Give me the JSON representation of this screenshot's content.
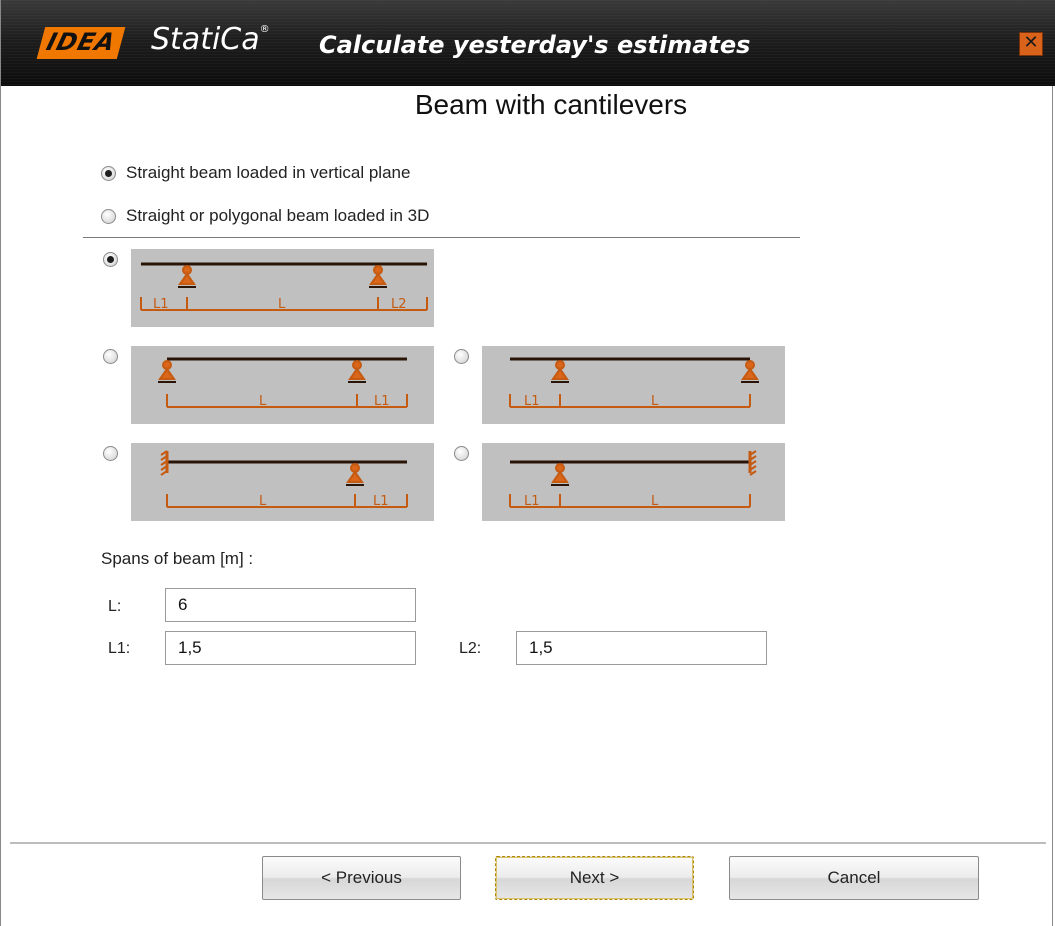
{
  "header": {
    "logo_idea": "IDEA",
    "logo_statica": "StatiCa",
    "logo_reg": "®",
    "tagline": "Calculate yesterday's estimates",
    "close_glyph": "✕",
    "accent_color": "#f07800"
  },
  "dialog": {
    "title": "Beam with cantilevers"
  },
  "load_type": {
    "options": [
      {
        "label": "Straight beam loaded in vertical plane",
        "checked": true
      },
      {
        "label": "Straight or polygonal beam loaded in 3D",
        "checked": false
      }
    ]
  },
  "beam_types": {
    "diagram_color": "#c55a11",
    "items": [
      {
        "name": "cantilevers-both-ends",
        "checked": true,
        "dims": [
          "L1",
          "L",
          "L2"
        ]
      },
      {
        "name": "cantilever-right",
        "checked": false,
        "dims": [
          "L",
          "L1"
        ]
      },
      {
        "name": "cantilever-left",
        "checked": false,
        "dims": [
          "L1",
          "L"
        ]
      },
      {
        "name": "fixed-left-cantilever-right",
        "checked": false,
        "dims": [
          "L",
          "L1"
        ]
      },
      {
        "name": "cantilever-left-fixed-right",
        "checked": false,
        "dims": [
          "L1",
          "L"
        ]
      }
    ]
  },
  "spans": {
    "label": "Spans of beam [m] :",
    "L": {
      "label": "L:",
      "value": "6"
    },
    "L1": {
      "label": "L1:",
      "value": "1,5"
    },
    "L2": {
      "label": "L2:",
      "value": "1,5"
    }
  },
  "buttons": {
    "previous": "< Previous",
    "next": "Next >",
    "cancel": "Cancel"
  }
}
